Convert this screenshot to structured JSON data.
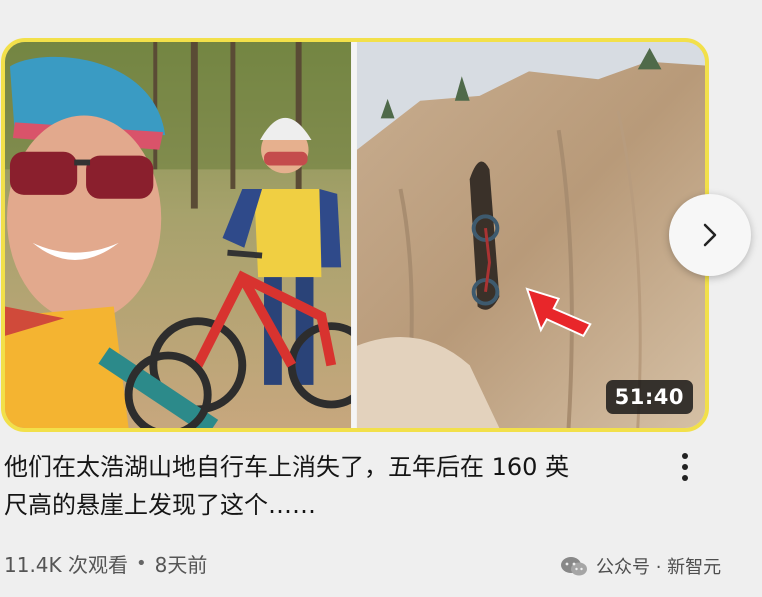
{
  "video": {
    "duration": "51:40",
    "title": "他们在太浩湖山地自行车上消失了，五年后在 160 英\n尺高的悬崖上发现了这个……",
    "views": "11.4K 次观看",
    "separator": "•",
    "age": "8天前"
  },
  "overlay": {
    "next_icon": "chevron-right-icon",
    "more_icon": "more-vertical-icon"
  },
  "watermark": {
    "icon": "wechat-icon",
    "text": "公众号 · 新智元"
  },
  "colors": {
    "frame": "#f2e04a",
    "duration_bg": "#141414",
    "page_bg": "#efefef",
    "arrow": "#e8262a"
  }
}
